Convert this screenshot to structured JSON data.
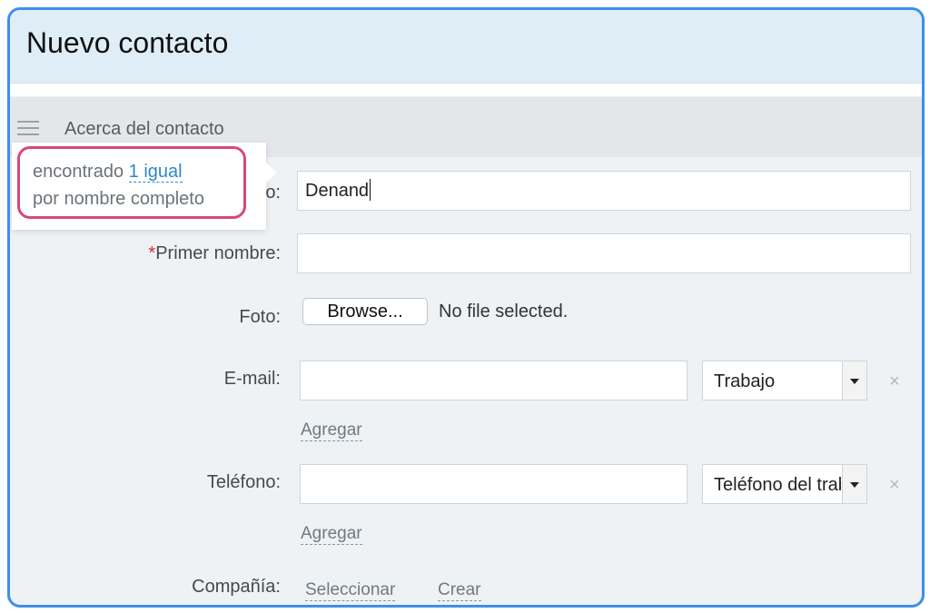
{
  "header": {
    "title": "Nuevo contacto"
  },
  "section": {
    "title": "Acerca del contacto"
  },
  "duplicate_popup": {
    "prefix": "encontrado ",
    "link": "1 igual",
    "line2": "por nombre completo"
  },
  "fields": {
    "last_name": {
      "label_suffix": "o:",
      "value": "Denand"
    },
    "first_name": {
      "required_mark": "*",
      "label": "Primer nombre:",
      "value": ""
    },
    "photo": {
      "label": "Foto:",
      "browse_label": "Browse...",
      "status": "No file selected."
    },
    "email": {
      "label": "E-mail:",
      "value": "",
      "type_selected": "Trabajo",
      "remove": "×",
      "add_label": "Agregar"
    },
    "phone": {
      "label": "Teléfono:",
      "value": "",
      "type_selected": "Teléfono del trabajo",
      "remove": "×",
      "add_label": "Agregar"
    },
    "company": {
      "label": "Compañía:",
      "select_label": "Seleccionar",
      "create_label": "Crear"
    }
  }
}
